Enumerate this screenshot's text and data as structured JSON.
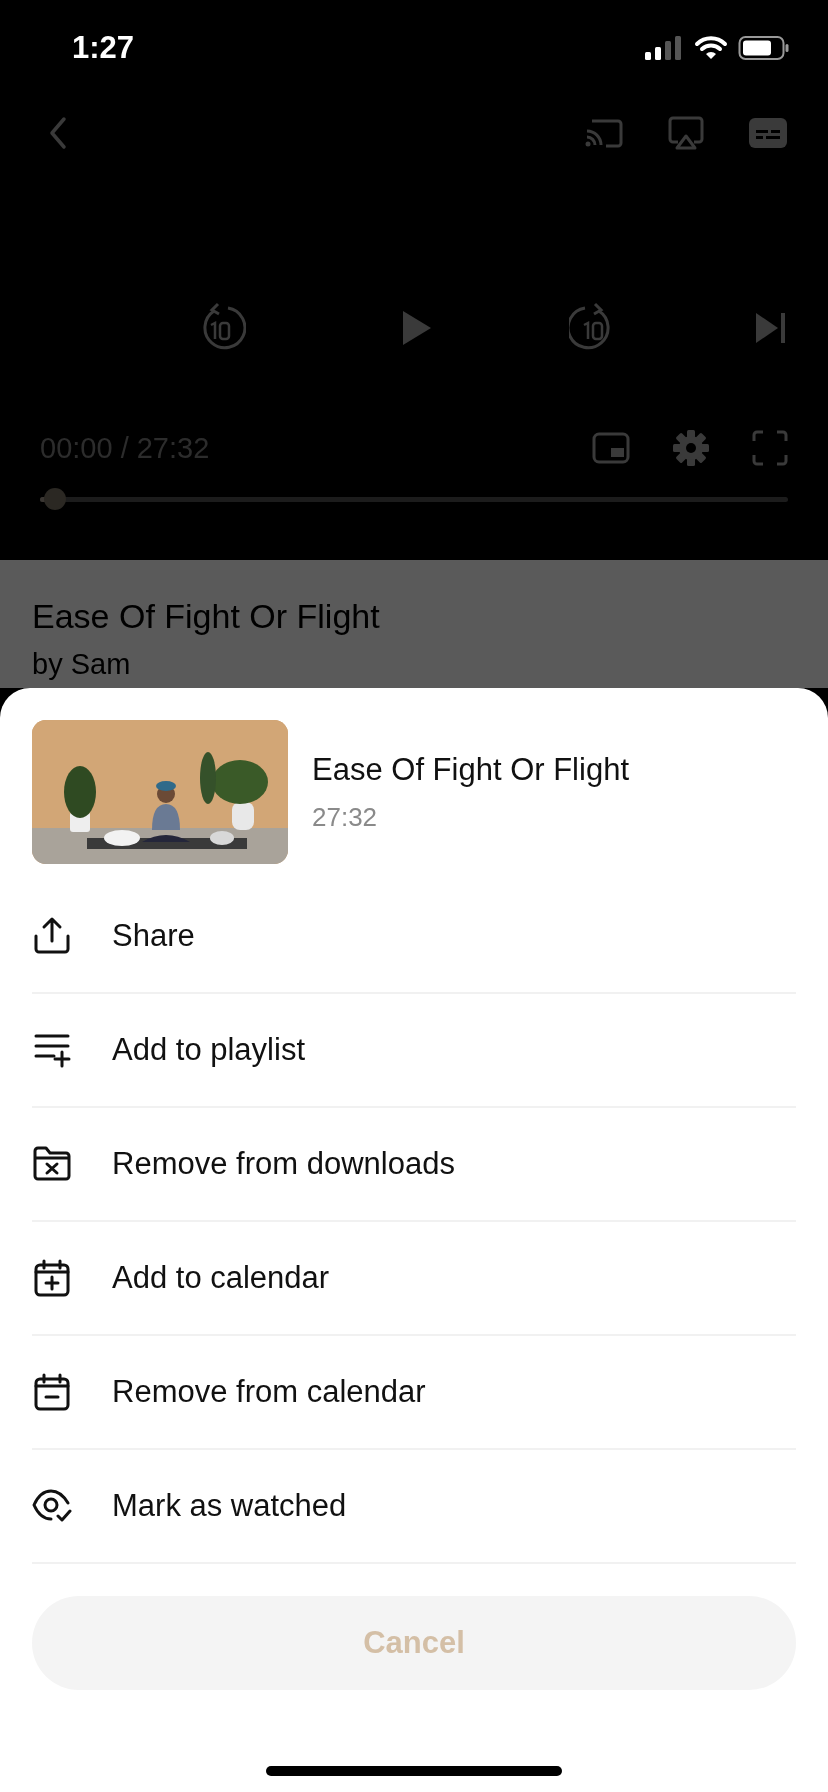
{
  "status_bar": {
    "time": "1:27"
  },
  "player": {
    "time_readout": "00:00 / 27:32",
    "progress": {
      "level": 0.02
    }
  },
  "video": {
    "title": "Ease Of Fight Or Flight",
    "author": "by Sam"
  },
  "sheet": {
    "title": "Ease Of Fight Or Flight",
    "duration": "27:32",
    "actions": [
      {
        "label": "Share",
        "kind": "share"
      },
      {
        "label": "Add to playlist",
        "kind": "playlist"
      },
      {
        "label": "Remove from downloads",
        "kind": "downloads"
      },
      {
        "label": "Add to calendar",
        "kind": "calendar_add"
      },
      {
        "label": "Remove from calendar",
        "kind": "calendar_remove"
      },
      {
        "label": "Mark as watched",
        "kind": "watched"
      }
    ],
    "cancel": "Cancel"
  }
}
